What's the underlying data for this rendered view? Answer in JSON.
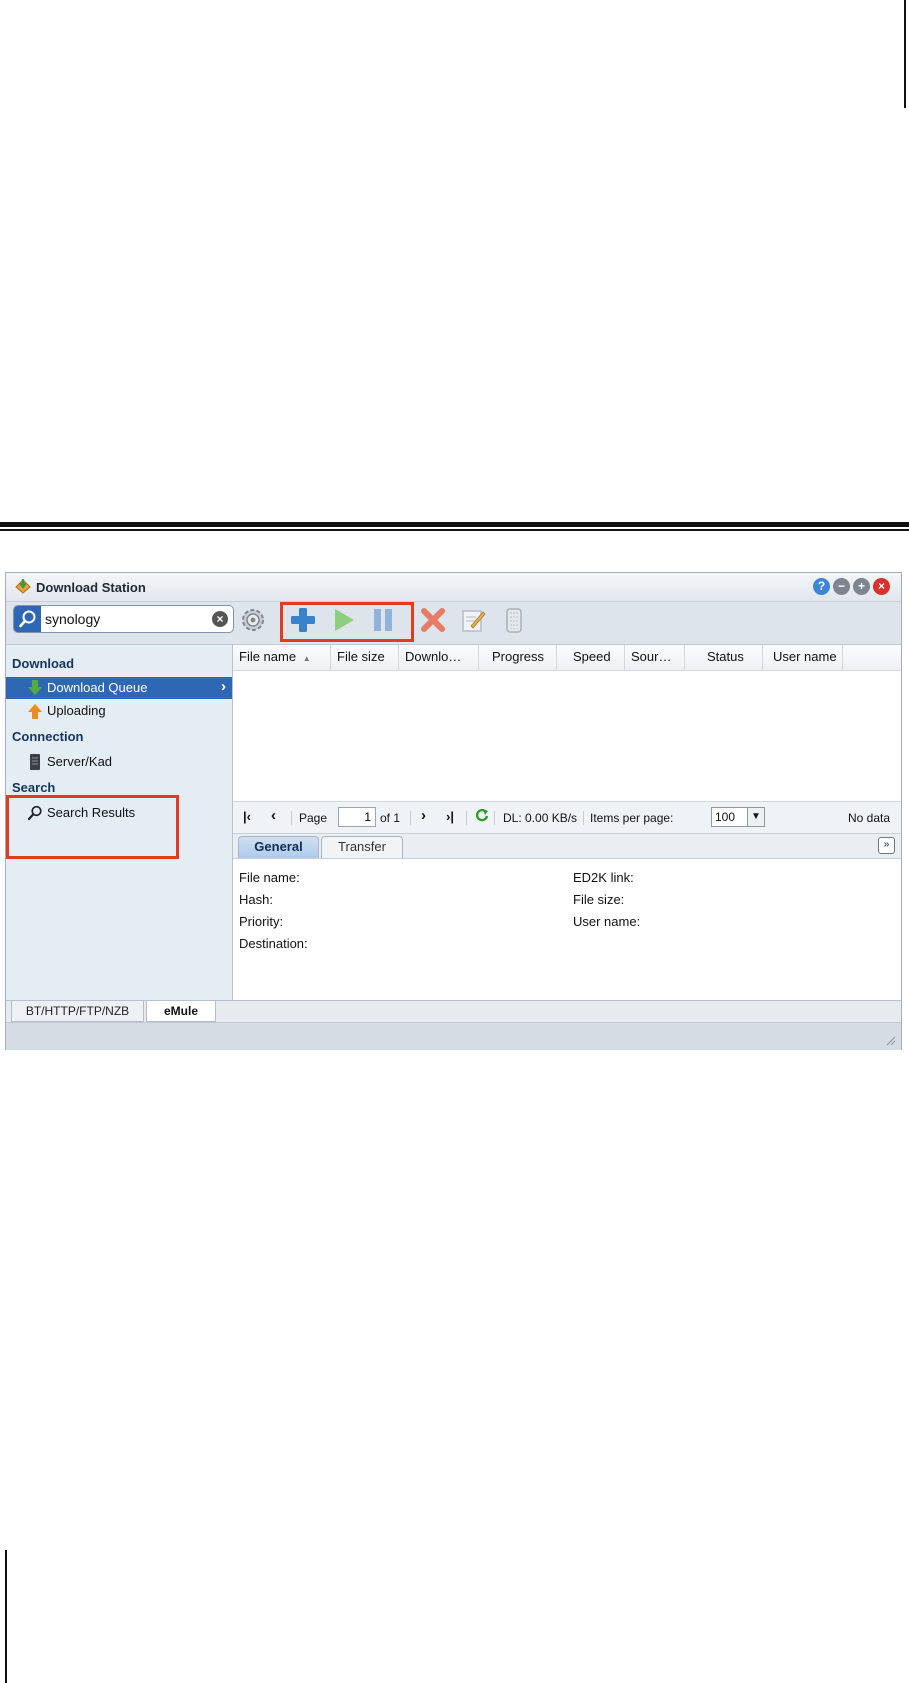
{
  "window": {
    "title": "Download Station"
  },
  "search": {
    "value": "synology"
  },
  "sidebar": {
    "download_header": "Download",
    "download_items": [
      {
        "label": "Download Queue",
        "selected": true
      },
      {
        "label": "Uploading",
        "selected": false
      }
    ],
    "connection_header": "Connection",
    "connection_items": [
      {
        "label": "Server/Kad"
      }
    ],
    "search_header": "Search",
    "search_items": [
      {
        "label": "Search Results"
      }
    ]
  },
  "grid": {
    "columns": [
      "File name",
      "File size",
      "Downlo…",
      "Progress",
      "Speed",
      "Sour…",
      "Status",
      "User name"
    ]
  },
  "pager": {
    "page_label": "Page",
    "page_value": "1",
    "of_label": "of 1",
    "dl_speed": "DL: 0.00 KB/s",
    "items_per_page_label": "Items per page:",
    "items_per_page_value": "100",
    "status": "No data"
  },
  "detail_tabs": {
    "general": "General",
    "transfer": "Transfer"
  },
  "details": {
    "left": [
      "File name:",
      "Hash:",
      "Priority:",
      "Destination:"
    ],
    "right": [
      "ED2K link:",
      "File size:",
      "User name:"
    ]
  },
  "bottom_tabs": {
    "bt": "BT/HTTP/FTP/NZB",
    "emule": "eMule"
  },
  "colors": {
    "accent": "#2e67b4",
    "highlight": "#e23b1f"
  }
}
